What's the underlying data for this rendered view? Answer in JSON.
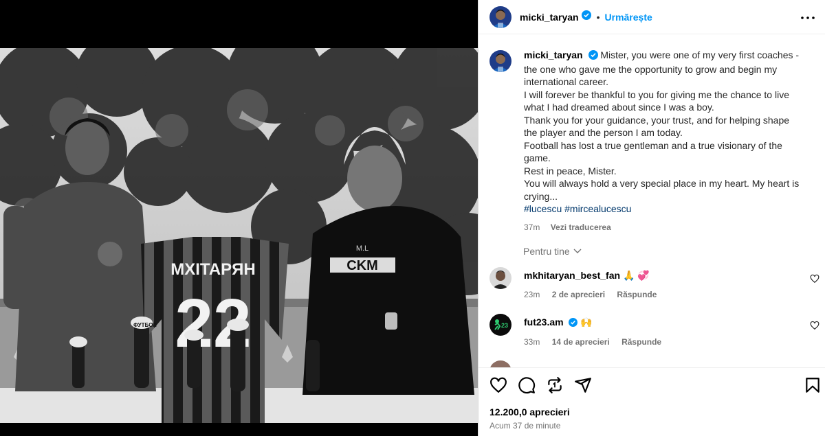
{
  "post": {
    "username": "micki_taryan",
    "follow_label": "Urmărește",
    "separator": "•"
  },
  "photo": {
    "jersey_name": "MXITAPЯH",
    "jersey_number": "22",
    "sponsor": "CKM",
    "initials": "M.L",
    "mic_brand": "ФУТБОЛ"
  },
  "caption": {
    "username": "micki_taryan",
    "lines": [
      "Mister, you were one of my very first coaches -",
      "the one who gave me the opportunity to grow and begin my",
      "international career.",
      "I will forever be thankful to you for giving me the chance to live",
      "what I had dreamed about since I was a boy.",
      "Thank you for your guidance, your trust, and for helping shape",
      "the player and the person I am today.",
      "Football has lost a true gentleman and a true visionary of the",
      "game.",
      "Rest in peace, Mister.",
      "You will always hold a very special place in my heart. My heart is",
      "crying..."
    ],
    "hashtags": "#lucescu #mircealucescu",
    "age": "37m",
    "translate": "Vezi traducerea"
  },
  "for_you": "Pentru tine",
  "comments": [
    {
      "username": "mkhitaryan_best_fan",
      "text": "🙏 💞",
      "age": "23m",
      "likes": "2 de aprecieri",
      "reply": "Răspunde"
    },
    {
      "username": "fut23.am",
      "text": "🙌",
      "age": "33m",
      "likes": "14 de aprecieri",
      "reply": "Răspunde"
    }
  ],
  "footer": {
    "likes": "12.200,0 aprecieri",
    "time": "Acum 37 de minute"
  },
  "colors": {
    "accent": "#0095f6",
    "hashtag": "#00376b",
    "muted": "#737373"
  },
  "icons": [
    "verified-badge-icon",
    "more-options-icon",
    "heart-icon",
    "comment-icon",
    "share-icon",
    "send-icon",
    "bookmark-icon",
    "chevron-down-icon"
  ]
}
